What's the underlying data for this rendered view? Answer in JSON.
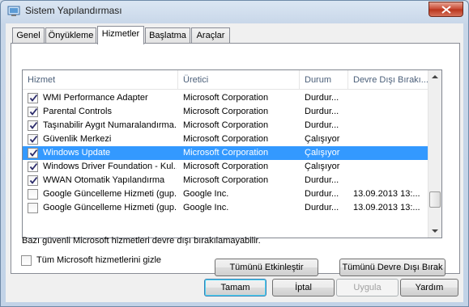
{
  "window": {
    "title": "Sistem Yapılandırması",
    "close_icon": "close-icon"
  },
  "tabs": [
    {
      "label": "Genel",
      "active": false
    },
    {
      "label": "Önyükleme",
      "active": false
    },
    {
      "label": "Hizmetler",
      "active": true
    },
    {
      "label": "Başlatma",
      "active": false
    },
    {
      "label": "Araçlar",
      "active": false
    }
  ],
  "services": {
    "columns": [
      "Hizmet",
      "Üretici",
      "Durum",
      "Devre Dışı Bırakı..."
    ],
    "rows": [
      {
        "name": "WMI Performance Adapter",
        "vendor": "Microsoft Corporation",
        "status": "Durdur...",
        "disabled_date": "",
        "checked": true,
        "selected": false
      },
      {
        "name": "Parental Controls",
        "vendor": "Microsoft Corporation",
        "status": "Durdur...",
        "disabled_date": "",
        "checked": true,
        "selected": false
      },
      {
        "name": "Taşınabilir Aygıt Numaralandırma...",
        "vendor": "Microsoft Corporation",
        "status": "Durdur...",
        "disabled_date": "",
        "checked": true,
        "selected": false
      },
      {
        "name": "Güvenlik Merkezi",
        "vendor": "Microsoft Corporation",
        "status": "Çalışıyor",
        "disabled_date": "",
        "checked": true,
        "selected": false
      },
      {
        "name": "Windows Update",
        "vendor": "Microsoft Corporation",
        "status": "Çalışıyor",
        "disabled_date": "",
        "checked": true,
        "selected": true
      },
      {
        "name": "Windows Driver Foundation - Kul...",
        "vendor": "Microsoft Corporation",
        "status": "Çalışıyor",
        "disabled_date": "",
        "checked": true,
        "selected": false
      },
      {
        "name": "WWAN Otomatik Yapılandırma",
        "vendor": "Microsoft Corporation",
        "status": "Durdur...",
        "disabled_date": "",
        "checked": true,
        "selected": false
      },
      {
        "name": "Google Güncelleme Hizmeti (gup...",
        "vendor": "Google Inc.",
        "status": "Durdur...",
        "disabled_date": "13.09.2013 13:...",
        "checked": false,
        "selected": false
      },
      {
        "name": "Google Güncelleme Hizmeti (gup...",
        "vendor": "Google Inc.",
        "status": "Durdur...",
        "disabled_date": "13.09.2013 13:...",
        "checked": false,
        "selected": false
      }
    ]
  },
  "note": "Bazı güvenli Microsoft hizmetleri devre dışı bırakılamayabilir.",
  "buttons": {
    "enable_all": "Tümünü Etkinleştir",
    "disable_all": "Tümünü Devre Dışı Bırak",
    "ok": "Tamam",
    "cancel": "İptal",
    "apply": "Uygula",
    "help": "Yardım"
  },
  "hide_ms_label": "Tüm Microsoft hizmetlerini gizle",
  "colors": {
    "selection": "#3399ff",
    "accent": "#3c7fb1"
  }
}
